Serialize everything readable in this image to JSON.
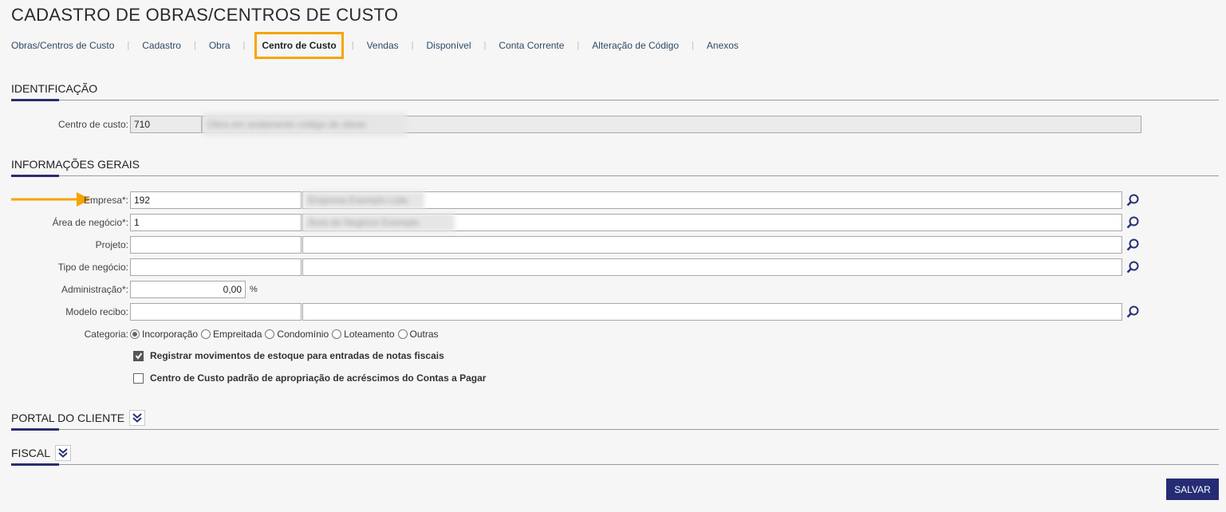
{
  "page_title": "CADASTRO DE OBRAS/CENTROS DE CUSTO",
  "tabs": [
    {
      "label": "Obras/Centros de Custo"
    },
    {
      "label": "Cadastro"
    },
    {
      "label": "Obra"
    },
    {
      "label": "Centro de Custo",
      "active": true
    },
    {
      "label": "Vendas"
    },
    {
      "label": "Disponível"
    },
    {
      "label": "Conta Corrente"
    },
    {
      "label": "Alteração de Código"
    },
    {
      "label": "Anexos"
    }
  ],
  "identificacao": {
    "title": "IDENTIFICAÇÃO",
    "centro_custo_label": "Centro de custo:",
    "centro_custo_code": "710",
    "centro_custo_desc": "Obra em andamento código de obras"
  },
  "info_gerais": {
    "title": "INFORMAÇÕES GERAIS",
    "empresa_label": "Empresa*:",
    "empresa_code": "192",
    "empresa_desc": "Empresa Exemplo Ltda",
    "area_label": "Área de negócio*:",
    "area_code": "1",
    "area_desc": "Área de Negócio Exemplo",
    "projeto_label": "Projeto:",
    "projeto_code": "",
    "projeto_desc": "",
    "tipo_label": "Tipo de negócio:",
    "tipo_code": "",
    "tipo_desc": "",
    "admin_label": "Administração*:",
    "admin_value": "0,00",
    "admin_unit": "%",
    "modelo_label": "Modelo recibo:",
    "modelo_code": "",
    "modelo_desc": "",
    "categoria_label": "Categoria:",
    "categorias": [
      {
        "label": "Incorporação",
        "selected": true
      },
      {
        "label": "Empreitada",
        "selected": false
      },
      {
        "label": "Condomínio",
        "selected": false
      },
      {
        "label": "Loteamento",
        "selected": false
      },
      {
        "label": "Outras",
        "selected": false
      }
    ],
    "check_estoque_label": "Registrar movimentos de estoque para entradas de notas fiscais",
    "check_estoque_checked": true,
    "check_acrescimos_label": "Centro de Custo padrão de apropriação de acréscimos do Contas a Pagar",
    "check_acrescimos_checked": false
  },
  "portal": {
    "title": "PORTAL DO CLIENTE"
  },
  "fiscal": {
    "title": "FISCAL"
  },
  "save_label": "SALVAR",
  "colors": {
    "accent": "#2b2e6e",
    "highlight": "#f7a400",
    "save_bg": "#252c73"
  }
}
